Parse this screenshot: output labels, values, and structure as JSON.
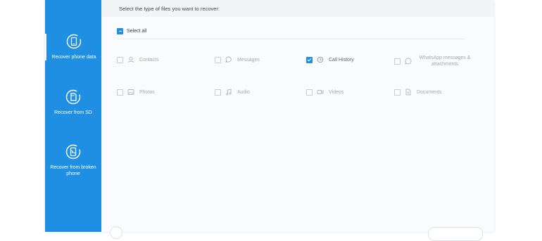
{
  "sidebar": {
    "items": [
      {
        "label": "Recover phone data",
        "icon": "phone-recover-icon",
        "active": true
      },
      {
        "label": "Recover from SD",
        "icon": "sd-card-icon",
        "active": false
      },
      {
        "label": "Recover from broken phone",
        "icon": "broken-phone-icon",
        "active": false
      }
    ]
  },
  "main": {
    "prompt": "Select the type of files you want to recover:",
    "select_all": {
      "label": "Select all",
      "state": "partial"
    },
    "file_types": [
      {
        "label": "Contacts",
        "icon": "contact-icon",
        "checked": false
      },
      {
        "label": "Messages",
        "icon": "message-icon",
        "checked": false
      },
      {
        "label": "Call History",
        "icon": "call-history-icon",
        "checked": true
      },
      {
        "label": "WhatsApp messages & attachments",
        "icon": "whatsapp-icon",
        "checked": false
      },
      {
        "label": "Photos",
        "icon": "photo-icon",
        "checked": false
      },
      {
        "label": "Audio",
        "icon": "audio-icon",
        "checked": false
      },
      {
        "label": "Videos",
        "icon": "video-icon",
        "checked": false
      },
      {
        "label": "Documents",
        "icon": "document-icon",
        "checked": false
      }
    ]
  },
  "colors": {
    "sidebar": "#1f8fe3",
    "accent": "#1f8fe3",
    "background": "#fafbfc"
  }
}
